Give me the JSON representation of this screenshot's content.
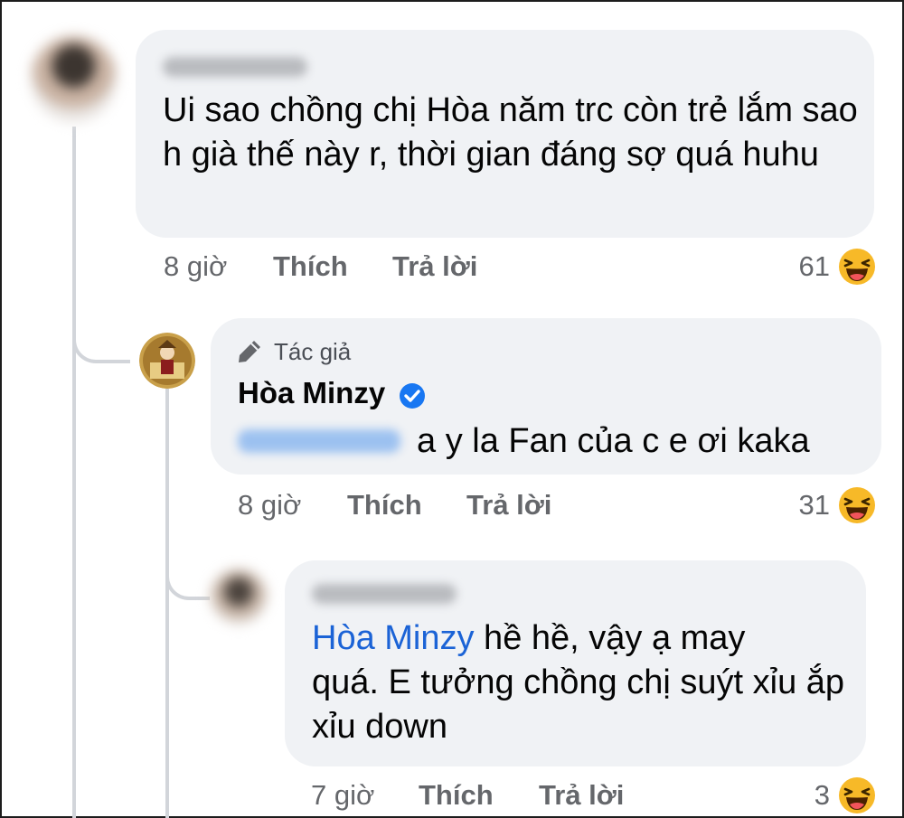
{
  "comments": [
    {
      "text": "Ui sao chồng chị Hòa năm trc còn trẻ lắm sao h già thế này r, thời gian đáng sợ quá huhu",
      "time": "8 giờ",
      "like_label": "Thích",
      "reply_label": "Trả lời",
      "reaction_count": "61",
      "reaction_icon": "laughing-emoji"
    },
    {
      "author_badge": "Tác giả",
      "author_name": "Hòa Minzy",
      "verified_icon": "verified-badge-icon",
      "text": "a y la Fan của c e ơi kaka",
      "time": "8 giờ",
      "like_label": "Thích",
      "reply_label": "Trả lời",
      "reaction_count": "31",
      "reaction_icon": "laughing-emoji"
    },
    {
      "mention": "Hòa Minzy",
      "text_after_mention": " hề hề, vậy ạ may",
      "text_rest": "quá. E tưởng chồng chị suýt xỉu ắp xỉu down",
      "time": "7 giờ",
      "like_label": "Thích",
      "reply_label": "Trả lời",
      "reaction_count": "3",
      "reaction_icon": "laughing-emoji"
    }
  ],
  "colors": {
    "bubble": "#f0f2f5",
    "meta_text": "#65676b",
    "link": "#1b63d6",
    "verified": "#1877f2",
    "thread_line": "#d2d5da"
  }
}
